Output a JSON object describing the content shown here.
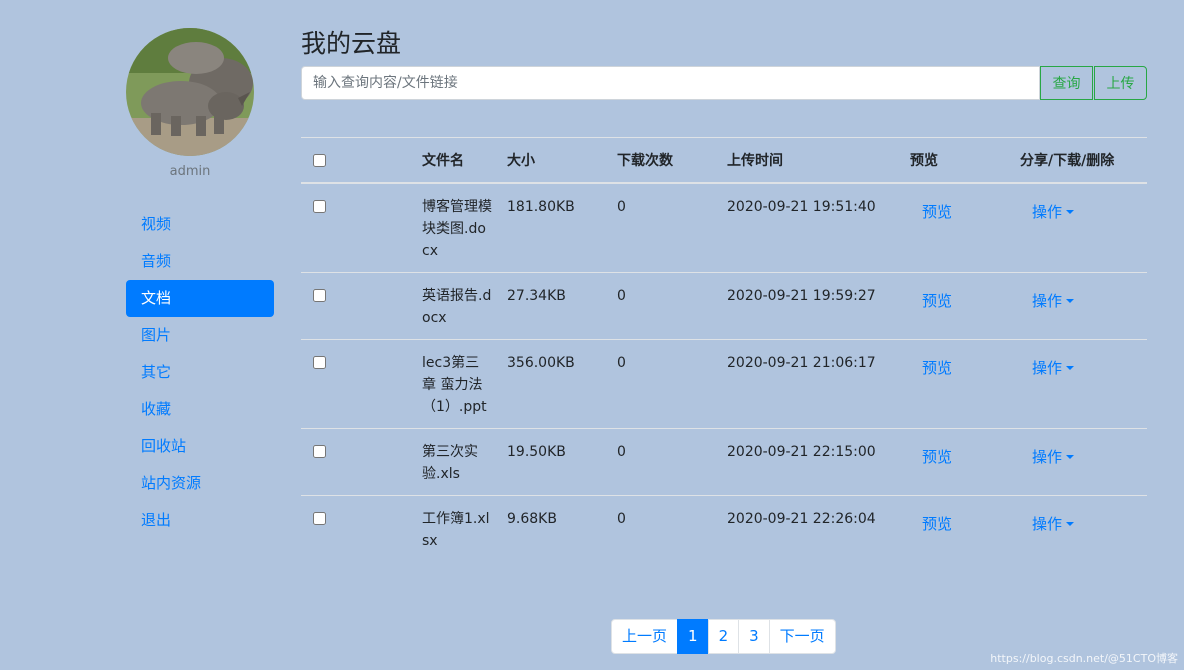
{
  "sidebar": {
    "username": "admin",
    "items": [
      {
        "label": "视频"
      },
      {
        "label": "音频"
      },
      {
        "label": "文档"
      },
      {
        "label": "图片"
      },
      {
        "label": "其它"
      },
      {
        "label": "收藏"
      },
      {
        "label": "回收站"
      },
      {
        "label": "站内资源"
      },
      {
        "label": "退出"
      }
    ],
    "active_index": 2
  },
  "main": {
    "title": "我的云盘",
    "search": {
      "placeholder": "输入查询内容/文件链接",
      "value": "",
      "search_label": "查询",
      "upload_label": "上传"
    },
    "table": {
      "headers": [
        "文件名",
        "大小",
        "下载次数",
        "上传时间",
        "预览",
        "分享/下载/删除"
      ],
      "preview_label": "预览",
      "action_label": "操作",
      "rows": [
        {
          "name": "博客管理模块类图.docx",
          "size": "181.80KB",
          "downloads": "0",
          "time": "2020-09-21 19:51:40"
        },
        {
          "name": "英语报告.docx",
          "size": "27.34KB",
          "downloads": "0",
          "time": "2020-09-21 19:59:27"
        },
        {
          "name": "lec3第三章 蛮力法（1）.ppt",
          "size": "356.00KB",
          "downloads": "0",
          "time": "2020-09-21 21:06:17"
        },
        {
          "name": "第三次实验.xls",
          "size": "19.50KB",
          "downloads": "0",
          "time": "2020-09-21 22:15:00"
        },
        {
          "name": "工作簿1.xlsx",
          "size": "9.68KB",
          "downloads": "0",
          "time": "2020-09-21 22:26:04"
        }
      ]
    }
  },
  "pagination": {
    "prev": "上一页",
    "pages": [
      "1",
      "2",
      "3"
    ],
    "current": "1",
    "next": "下一页"
  },
  "watermark": "https://blog.csdn.net/@51CTO博客",
  "colors": {
    "background": "#b0c4de",
    "primary": "#007bff",
    "success": "#28a745"
  }
}
